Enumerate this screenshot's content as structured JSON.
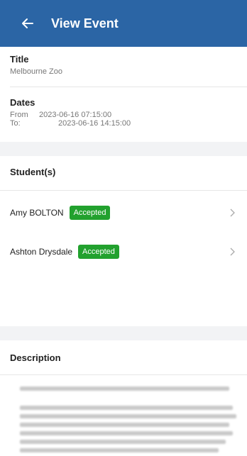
{
  "header": {
    "title": "View Event",
    "back_icon": "arrow-left-icon"
  },
  "title_section": {
    "label": "Title",
    "value": "Melbourne Zoo"
  },
  "dates_section": {
    "label": "Dates",
    "from_label": "From",
    "from_value": "2023-06-16 07:15:00",
    "to_label": "To:",
    "to_value": "2023-06-16 14:15:00"
  },
  "students_section": {
    "label": "Student(s)",
    "students": [
      {
        "name": "Amy BOLTON",
        "status": "Accepted"
      },
      {
        "name": "Ashton Drysdale",
        "status": "Accepted"
      }
    ]
  },
  "description_section": {
    "label": "Description"
  },
  "colors": {
    "appbar": "#2b65a5",
    "badge": "#22a12e",
    "band": "#f2f3f5"
  }
}
